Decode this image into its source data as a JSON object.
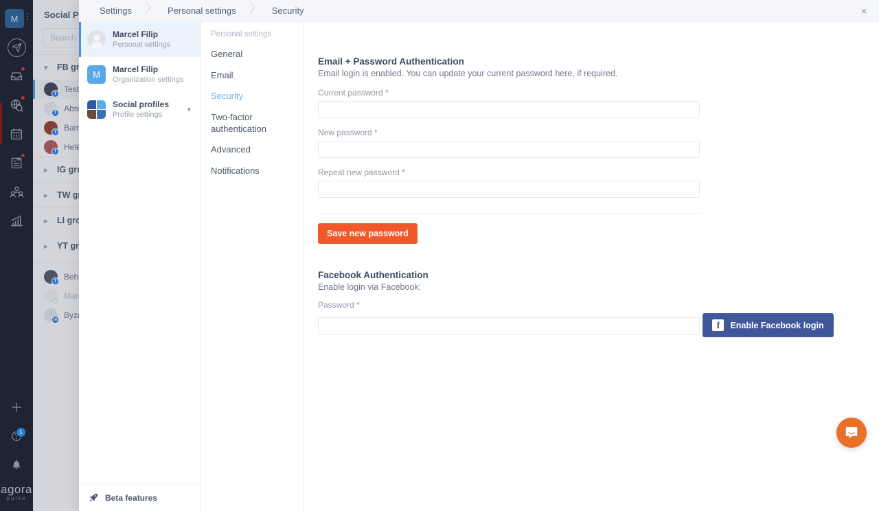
{
  "rail": {
    "logo_letter": "M",
    "menu_icon": "three-dots-vertical-icon",
    "icons": [
      {
        "name": "send-paper-plane-icon",
        "badge": ""
      },
      {
        "name": "inbox-tray-icon",
        "badge": "dot"
      },
      {
        "name": "globe-search-icon",
        "badge": "dot"
      },
      {
        "name": "calendar-icon",
        "badge": ""
      },
      {
        "name": "clipboard-notes-icon",
        "badge": "dot"
      },
      {
        "name": "team-users-icon",
        "badge": ""
      },
      {
        "name": "analytics-bar-chart-icon",
        "badge": ""
      }
    ],
    "bottom_icons": [
      {
        "name": "plus-add-icon",
        "badge": ""
      },
      {
        "name": "help-question-icon",
        "badge": "1"
      },
      {
        "name": "bell-notifications-icon",
        "badge": ""
      }
    ],
    "brand_top": "agora",
    "brand_bottom": "pulse"
  },
  "background_panel": {
    "title": "Social Profiles",
    "search_placeholder": "Search...",
    "groups": [
      {
        "label": "FB groups",
        "expanded": true
      },
      {
        "label": "IG groups",
        "expanded": false
      },
      {
        "label": "TW groups",
        "expanded": false
      },
      {
        "label": "LI groups",
        "expanded": false
      },
      {
        "label": "YT groups",
        "expanded": false
      }
    ],
    "fb_profiles": [
      {
        "label": "Testovací",
        "color": "#2b3245",
        "network": "f",
        "selected": true
      },
      {
        "label": "Absurdita",
        "color": "#e8eaee",
        "network": "f",
        "selected": false
      },
      {
        "label": "Bambule",
        "color": "#8a2b1d",
        "network": "f",
        "selected": false
      },
      {
        "label": "Heléké",
        "color": "#a8494a",
        "network": "f",
        "selected": false
      }
    ],
    "other_profiles": [
      {
        "label": "Beh v Tatrach",
        "color": "#3d4a5c",
        "network": "f",
        "dim": false
      },
      {
        "label": "Marcel",
        "color": "#f0f1f4",
        "network": "ig",
        "dim": true
      },
      {
        "label": "Byznys",
        "color": "#dfe3e9",
        "network": "in",
        "dim": false
      }
    ]
  },
  "modal": {
    "breadcrumbs": [
      "Settings",
      "Personal settings",
      "Security"
    ],
    "close_label": "×",
    "accounts": [
      {
        "name": "Marcel Filip",
        "sub": "Personal settings",
        "avatar": "person",
        "active": true,
        "chevron": false
      },
      {
        "name": "Marcel Filip",
        "sub": "Organization settings",
        "avatar": "letter",
        "letter": "M",
        "active": false,
        "chevron": false
      },
      {
        "name": "Social profiles",
        "sub": "Profile settings",
        "avatar": "grid",
        "active": false,
        "chevron": true
      }
    ],
    "beta_label": "Beta features",
    "beta_icon": "rocket-icon",
    "subnav_heading": "Personal settings",
    "subnav": [
      {
        "label": "General",
        "active": false
      },
      {
        "label": "Email",
        "active": false
      },
      {
        "label": "Security",
        "active": true
      },
      {
        "label": "Two-factor authentication",
        "active": false
      },
      {
        "label": "Advanced",
        "active": false
      },
      {
        "label": "Notifications",
        "active": false
      }
    ],
    "email_section": {
      "title": "Email + Password Authentication",
      "description": "Email login is enabled. You can update your current password here, if required.",
      "fields": [
        {
          "label": "Current password *",
          "value": "",
          "placeholder": ""
        },
        {
          "label": "New password *",
          "value": "",
          "placeholder": ""
        },
        {
          "label": "Repeat new password *",
          "value": "",
          "placeholder": ""
        }
      ],
      "submit_label": "Save new password"
    },
    "facebook_section": {
      "title": "Facebook Authentication",
      "description": "Enable login via Facebook:",
      "field": {
        "label": "Password *",
        "value": "",
        "placeholder": ""
      },
      "submit_label": "Enable Facebook login",
      "submit_icon": "facebook-f-icon"
    }
  },
  "chat_widget": {
    "icon": "intercom-chat-icon"
  },
  "colors": {
    "rail_bg": "#1d2433",
    "accent_orange": "#f1592a",
    "facebook_blue": "#40579b",
    "link_blue": "#72b3e8",
    "chat_orange": "#e8702a"
  }
}
